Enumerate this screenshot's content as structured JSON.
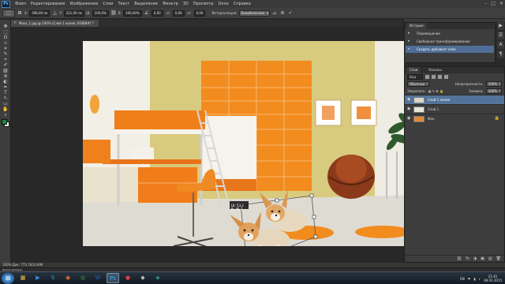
{
  "app": {
    "logo": "Ps"
  },
  "menu": {
    "items": [
      "Файл",
      "Редактирование",
      "Изображение",
      "Слои",
      "Текст",
      "Выделение",
      "Фильтр",
      "3D",
      "Просмотр",
      "Окно",
      "Справка"
    ],
    "window_controls": [
      "–",
      "□",
      "✕"
    ]
  },
  "options_bar": {
    "tool_glyph": "⬚",
    "x_label": "X:",
    "x_value": "398,00 пк",
    "y_label": "Y:",
    "y_value": "321,00 пк",
    "w_label": "Ш:",
    "w_value": "100,0%",
    "h_label": "В:",
    "h_value": "100,00%",
    "angle_value": "0,00",
    "hskew_value": "0,00",
    "vskew_value": "0,00",
    "interpolation_label": "Интерполяция:",
    "interpolation_value": "Бикубическая",
    "cancel_glyph": "⊘",
    "commit_glyph": "✓"
  },
  "document": {
    "tab_title": "Maxx_1.jpg @ 100% (Слой 1 копия, RGB/8#) *",
    "close_glyph": "×",
    "transform_readout": "Ш: 53,2\nВ: 48,3"
  },
  "tools": [
    "✥",
    "⬚",
    "ʘ",
    "⊹",
    "⌗",
    "✎",
    "⌖",
    "✐",
    "▨",
    "⊛",
    "◐",
    "✒",
    "T",
    "↖",
    "▭",
    "✋",
    "⌕"
  ],
  "history": {
    "tabs": [
      "История"
    ],
    "items": [
      {
        "label": "Перемещение",
        "selected": false
      },
      {
        "label": "Свободное трансформирование",
        "selected": false
      },
      {
        "label": "Создать дубликат слоя",
        "selected": true
      }
    ]
  },
  "side_icons": [
    "▶",
    "☰",
    "A",
    "¶"
  ],
  "layers": {
    "tabs": [
      "Слои",
      "Каналы"
    ],
    "search_label": "Вид",
    "blend_mode": "Обычные",
    "opacity_label": "Непрозрачность:",
    "opacity_value": "100%",
    "lock_label": "Закрепить:",
    "fill_label": "Заливка:",
    "fill_value": "100%",
    "items": [
      {
        "name": "Слой 1 копия",
        "selected": true,
        "thumb": "#dad6cc",
        "locked": false
      },
      {
        "name": "Слой 1",
        "selected": false,
        "thumb": "#e8e4da",
        "locked": false
      },
      {
        "name": "Фон",
        "selected": false,
        "thumb": "#e08a3a",
        "locked": true
      }
    ],
    "footer_icons": [
      "⛓",
      "fx",
      "◑",
      "▣",
      "▤",
      "🗑"
    ]
  },
  "status": {
    "zoom_doc": "100%    Док: 773,7K/2,04M"
  },
  "timeline": {
    "label": "Шкала времени"
  },
  "taskbar": {
    "start": "⊞",
    "apps": [
      {
        "name": "explorer",
        "glyph": "▦",
        "color": "#f0c040",
        "active": false
      },
      {
        "name": "media-player",
        "glyph": "▶",
        "color": "#3a8ee6",
        "active": false
      },
      {
        "name": "skype",
        "glyph": "S",
        "color": "#2aa8e0",
        "active": false
      },
      {
        "name": "firefox",
        "glyph": "◉",
        "color": "#e8742a",
        "active": false
      },
      {
        "name": "chrome",
        "glyph": "◎",
        "color": "#4caf50",
        "active": false
      },
      {
        "name": "word",
        "glyph": "W",
        "color": "#2b5fb6",
        "active": false
      },
      {
        "name": "photoshop",
        "glyph": "Ps",
        "color": "#31a8ff",
        "active": true
      },
      {
        "name": "app-red",
        "glyph": "●",
        "color": "#d94040",
        "active": false
      },
      {
        "name": "app-gray",
        "glyph": "◆",
        "color": "#bbbbbb",
        "active": false
      },
      {
        "name": "app-teal",
        "glyph": "◈",
        "color": "#2ab0a0",
        "active": false
      }
    ],
    "language": "EN",
    "time": "21:41",
    "date": "08.01.2015"
  }
}
